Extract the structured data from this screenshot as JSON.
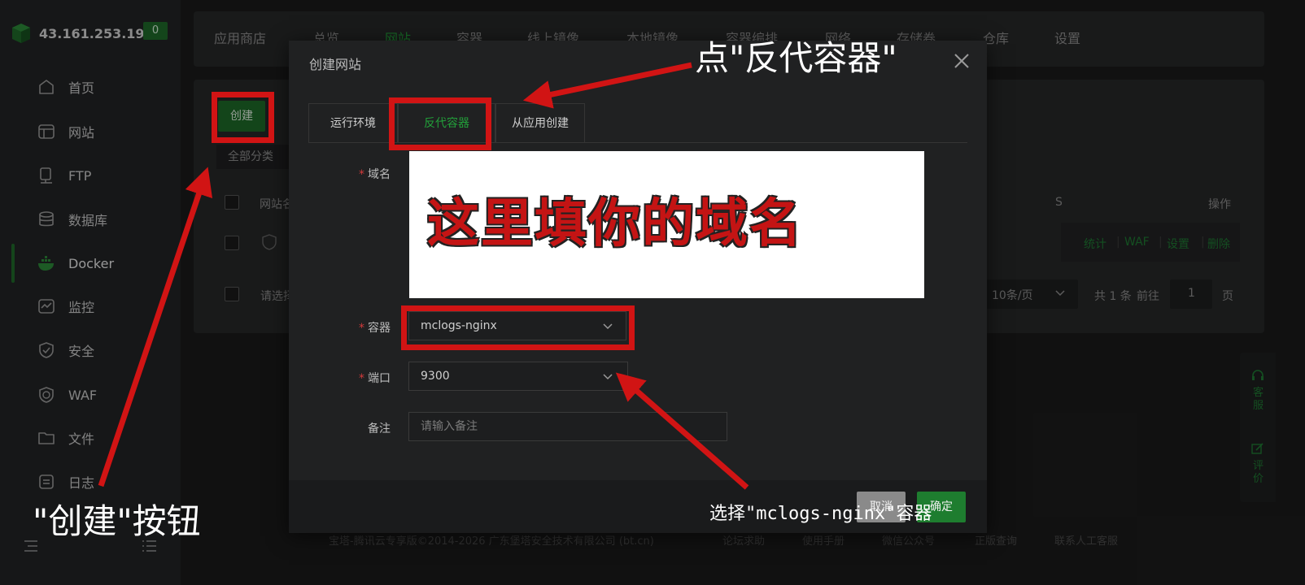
{
  "sidebar": {
    "ip": "43.161.253.19",
    "badge": "0",
    "items": [
      {
        "label": "首页",
        "icon": "home-icon"
      },
      {
        "label": "网站",
        "icon": "website-icon"
      },
      {
        "label": "FTP",
        "icon": "ftp-icon"
      },
      {
        "label": "数据库",
        "icon": "database-icon"
      },
      {
        "label": "Docker",
        "icon": "docker-icon"
      },
      {
        "label": "监控",
        "icon": "monitor-icon"
      },
      {
        "label": "安全",
        "icon": "shield-icon"
      },
      {
        "label": "WAF",
        "icon": "waf-icon"
      },
      {
        "label": "文件",
        "icon": "folder-icon"
      },
      {
        "label": "日志",
        "icon": "log-icon"
      }
    ],
    "active": "Docker"
  },
  "topnav": {
    "tabs": [
      "应用商店",
      "总览",
      "网站",
      "容器",
      "线上镜像",
      "本地镜像",
      "容器编排",
      "网络",
      "存储卷",
      "仓库",
      "设置"
    ]
  },
  "main": {
    "create_label": "创建",
    "filter_label": "全部分类",
    "table_header": {
      "name": "网站名",
      "ssl_partial": "S",
      "ops": "操作"
    },
    "row_actions": [
      "统计",
      "WAF",
      "设置",
      "删除"
    ],
    "batch_select": "请选择",
    "page_size": "10条/页",
    "total": "共 1 条",
    "goto_label": "前往",
    "page_num": "1",
    "page_unit": "页"
  },
  "modal": {
    "title": "创建网站",
    "tabs": [
      {
        "label": "运行环境",
        "active": false
      },
      {
        "label": "反代容器",
        "active": true
      },
      {
        "label": "从应用创建",
        "active": false
      }
    ],
    "fields": {
      "domain_label": "域名",
      "container_label": "容器",
      "container_value": "mclogs-nginx",
      "port_label": "端口",
      "port_value": "9300",
      "remark_label": "备注",
      "remark_placeholder": "请输入备注"
    },
    "cancel_label": "取消",
    "confirm_label": "确定"
  },
  "footer": {
    "copyright": "宝塔-腾讯云专享版©2014-2026 广东堡塔安全技术有限公司 (bt.cn)",
    "links": [
      "论坛求助",
      "使用手册",
      "微信公众号",
      "正版查询",
      "联系人工客服"
    ]
  },
  "float_panel": {
    "support": "客服",
    "review": "评价"
  },
  "annotations": {
    "domain_note": "这里填你的域名",
    "tab_note": "点\"反代容器\"",
    "create_note": "\"创建\"按钮",
    "select_note": "选择\"mclogs-nginx\"容器"
  },
  "colors": {
    "accent": "#1e7d2f",
    "annotation_red": "#d11414",
    "background": "#1b1b1b"
  }
}
